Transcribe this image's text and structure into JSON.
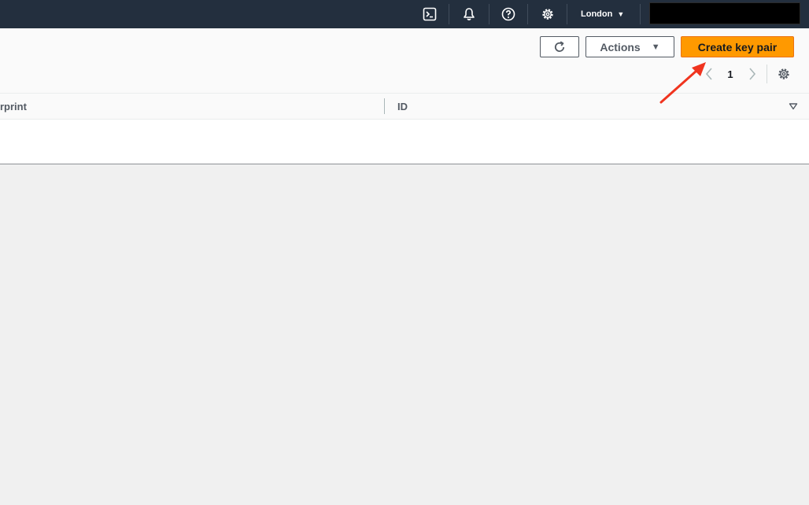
{
  "topbar": {
    "icons": [
      "cloudshell-icon",
      "notifications-bell-icon",
      "help-icon",
      "settings-icon"
    ],
    "region_label": "London",
    "region_caret": "▼"
  },
  "toolbar": {
    "refresh_icon": "refresh-icon",
    "actions_label": "Actions",
    "actions_caret": "▼",
    "create_label": "Create key pair"
  },
  "pagination": {
    "current_page": "1",
    "prev_icon": "chevron-left-icon",
    "next_icon": "chevron-right-icon",
    "settings_icon": "gear-icon"
  },
  "table": {
    "columns": [
      "rprint",
      "ID"
    ],
    "sort_icon": "sort-down-icon"
  },
  "colors": {
    "topbar_bg": "#232f3e",
    "primary_button": "#ff9900",
    "annotation_arrow": "#f0341f",
    "page_bg": "#f0f0f0"
  }
}
